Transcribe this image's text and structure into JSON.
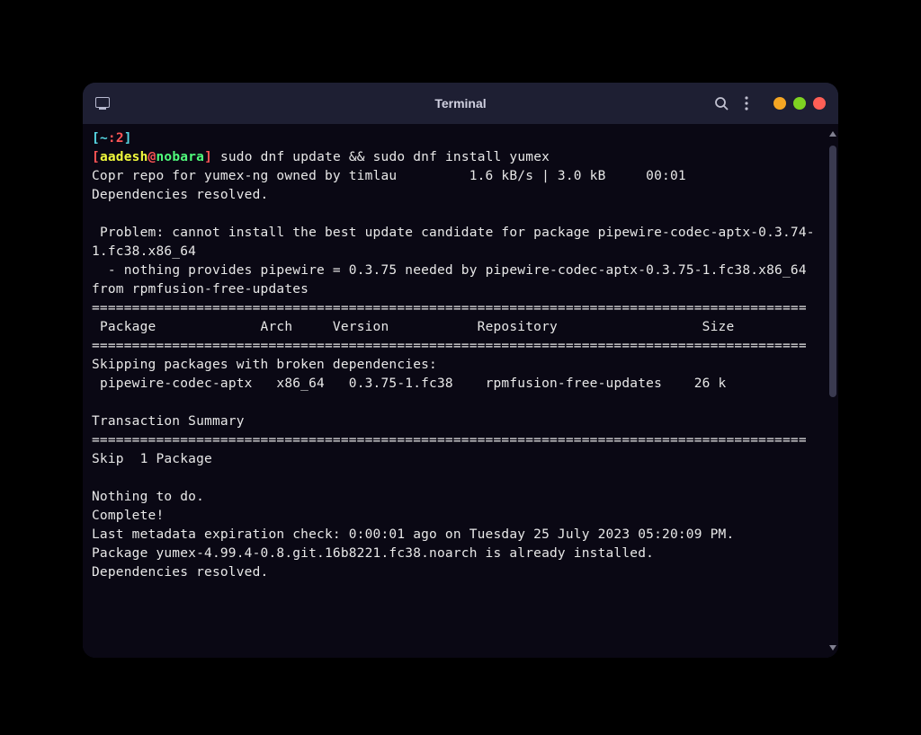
{
  "titlebar": {
    "title": "Terminal"
  },
  "prompt": {
    "cwd_abbrev": "~",
    "history_num": "2",
    "user": "aadesh",
    "at": "@",
    "host": "nobara",
    "command": "sudo dnf update && sudo dnf install yumex"
  },
  "output": {
    "line_repo": "Copr repo for yumex-ng owned by timlau         1.6 kB/s | 3.0 kB     00:01",
    "line_deps1": "Dependencies resolved.",
    "line_blank1": "",
    "line_problem1": " Problem: cannot install the best update candidate for package pipewire-codec-aptx-0.3.74-1.fc38.x86_64",
    "line_problem2": "  - nothing provides pipewire = 0.3.75 needed by pipewire-codec-aptx-0.3.75-1.fc38.x86_64 from rpmfusion-free-updates",
    "line_div1": "=========================================================================================",
    "line_header": " Package             Arch     Version           Repository                  Size",
    "line_div2": "=========================================================================================",
    "line_skip_hdr": "Skipping packages with broken dependencies:",
    "line_pkg": " pipewire-codec-aptx   x86_64   0.3.75-1.fc38    rpmfusion-free-updates    26 k",
    "line_blank2": "",
    "line_tx": "Transaction Summary",
    "line_div3": "=========================================================================================",
    "line_skip": "Skip  1 Package",
    "line_blank3": "",
    "line_nothing": "Nothing to do.",
    "line_complete": "Complete!",
    "line_meta": "Last metadata expiration check: 0:00:01 ago on Tuesday 25 July 2023 05:20:09 PM.",
    "line_installed": "Package yumex-4.99.4-0.8.git.16b8221.fc38.noarch is already installed.",
    "line_deps2": "Dependencies resolved."
  }
}
